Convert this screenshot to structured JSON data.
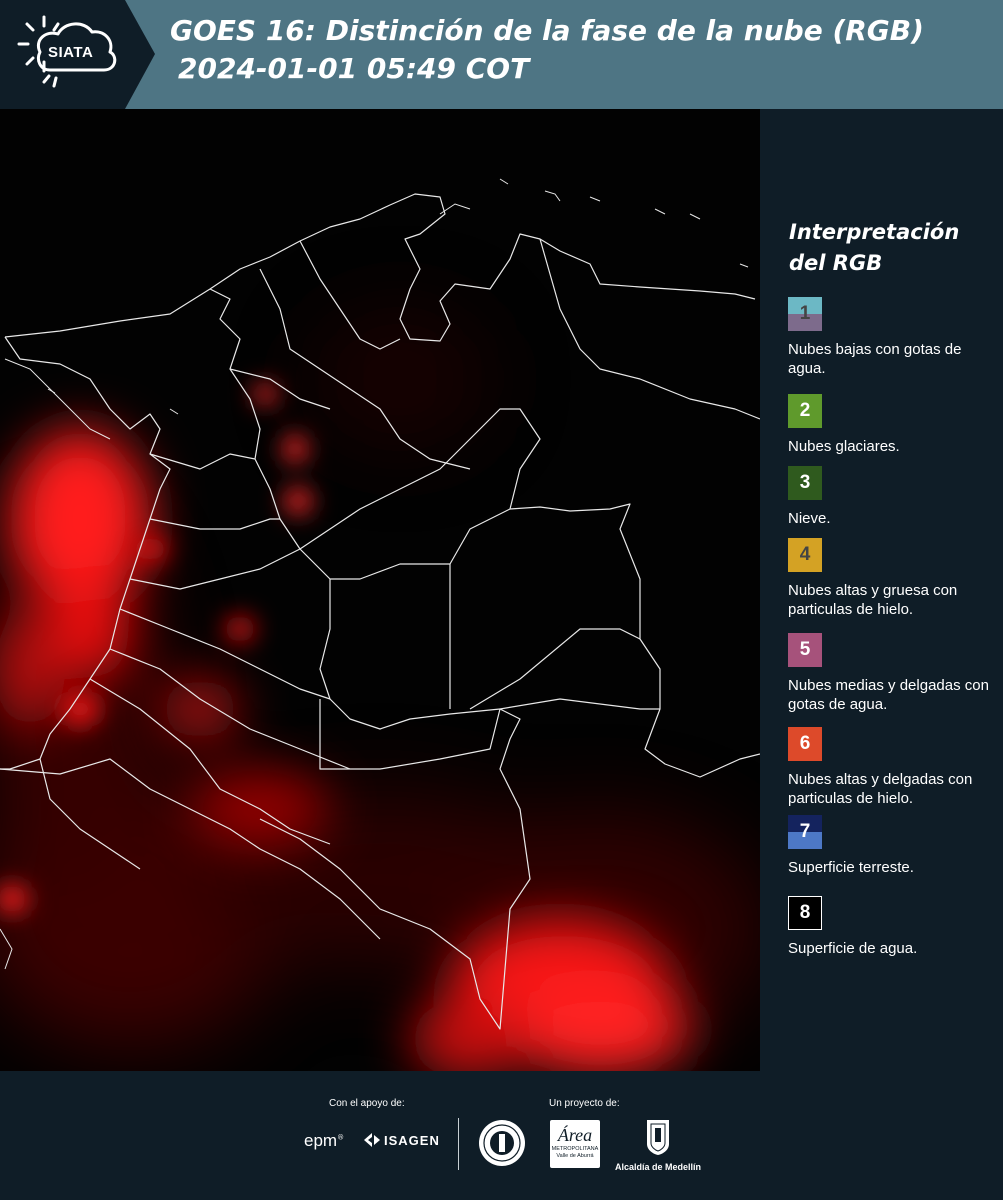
{
  "header": {
    "logo_text": "SIATA",
    "title_line1": "GOES 16: Distinción de la fase de la nube (RGB)",
    "title_line2": "2024-01-01 05:49 COT"
  },
  "legend": {
    "title_line1": "Interpretación",
    "title_line2": "del RGB",
    "items": [
      {
        "num": "1",
        "desc": "Nubes bajas con gotas de agua.",
        "colors": [
          "#6cb8c5",
          "#7d6b8c"
        ],
        "num_color": "#444444"
      },
      {
        "num": "2",
        "desc": "Nubes glaciares.",
        "colors": [
          "#5f9a2c"
        ],
        "num_color": "#ffffff"
      },
      {
        "num": "3",
        "desc": "Nieve.",
        "colors": [
          "#2f5a1e"
        ],
        "num_color": "#ffffff"
      },
      {
        "num": "4",
        "desc": "Nubes altas y gruesa con particulas de hielo.",
        "colors": [
          "#d4a224"
        ],
        "num_color": "#444444"
      },
      {
        "num": "5",
        "desc": "Nubes medias y delgadas con gotas de agua.",
        "colors": [
          "#a6527b"
        ],
        "num_color": "#ffffff"
      },
      {
        "num": "6",
        "desc": "Nubes altas y delgadas con particulas de hielo.",
        "colors": [
          "#dd4a2a"
        ],
        "num_color": "#ffffff"
      },
      {
        "num": "7",
        "desc": "Superficie terreste.",
        "colors": [
          "#14235e",
          "#4d78c6"
        ],
        "num_color": "#ffffff"
      },
      {
        "num": "8",
        "desc": "Superficie de agua.",
        "colors": [
          "#000000"
        ],
        "num_color": "#ffffff"
      }
    ]
  },
  "footer": {
    "support_label": "Con el apoyo de:",
    "project_label": "Un proyecto de:",
    "sponsor_epm": "epm",
    "sponsor_isagen": "ISAGEN",
    "area_logo_text": "Área",
    "area_subtext_1": "METROPOLITANA",
    "area_subtext_2": "Valle de Aburrá",
    "alcaldia_text": "Alcaldía de Medellín"
  }
}
